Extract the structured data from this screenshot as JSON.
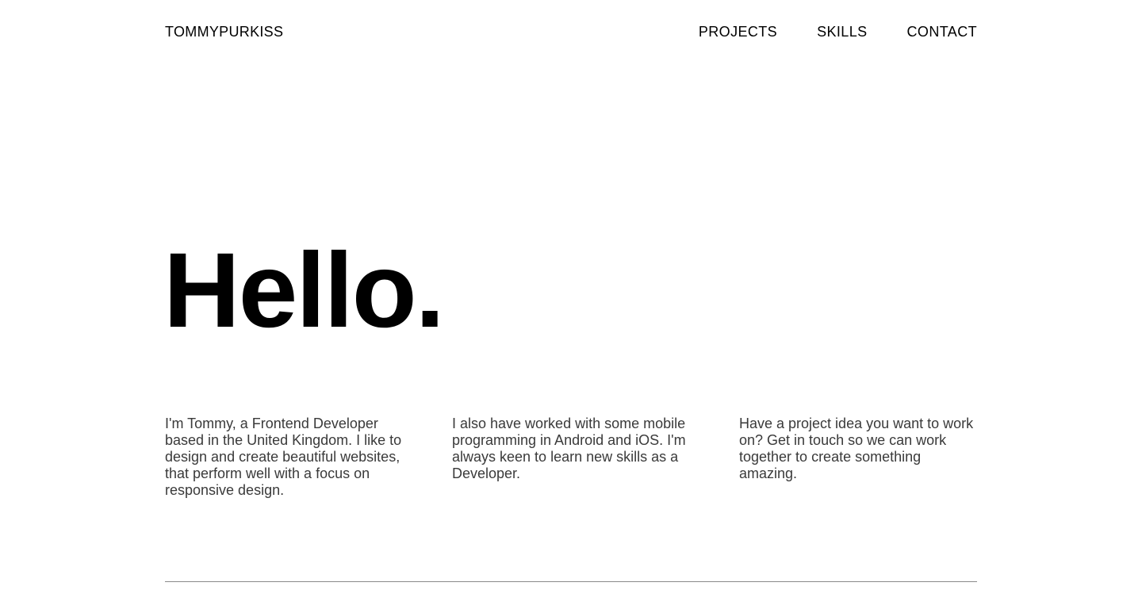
{
  "header": {
    "brand": "TOMMYPURKISS",
    "nav": {
      "projects": "PROJECTS",
      "skills": "SKILLS",
      "contact": "CONTACT"
    }
  },
  "hero": {
    "title": "Hello."
  },
  "intro": {
    "col1": "I'm Tommy, a Frontend Developer based in the United Kingdom. I like to design and create beautiful websites, that perform well with a focus on responsive design.",
    "col2": "I also have worked with some mobile programming in Android and iOS. I'm always keen to learn new skills as a Developer.",
    "col3": "Have a project idea you want to work on? Get in touch so we can work together to create something amazing."
  }
}
